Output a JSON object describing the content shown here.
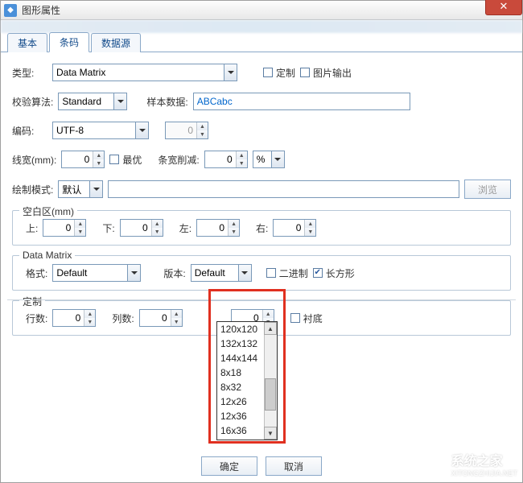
{
  "window": {
    "title": "图形属性"
  },
  "tabs": [
    "基本",
    "条码",
    "数据源"
  ],
  "activeTab": 1,
  "typeRow": {
    "label": "类型:",
    "value": "Data Matrix",
    "custom": "定制",
    "imgout": "图片输出"
  },
  "checkRow": {
    "label": "校验算法:",
    "value": "Standard",
    "sampleLabel": "样本数据:",
    "sampleValue": "ABCabc"
  },
  "encodeRow": {
    "label": "编码:",
    "value": "UTF-8",
    "spin": "0"
  },
  "widthRow": {
    "label": "线宽(mm):",
    "spin": "0",
    "optimal": "最优",
    "reduceLabel": "条宽削减:",
    "reduce": "0",
    "unit": "%"
  },
  "drawRow": {
    "label": "绘制模式:",
    "value": "默认",
    "browse": "浏览"
  },
  "blank": {
    "legend": "空白区(mm)",
    "up": "上:",
    "down": "下:",
    "left": "左:",
    "right": "右:",
    "v": "0"
  },
  "dm": {
    "legend": "Data Matrix",
    "formatLabel": "格式:",
    "format": "Default",
    "versionLabel": "版本:",
    "version": "Default",
    "binary": "二进制",
    "rect": "长方形",
    "rectChecked": true
  },
  "versionOptions": [
    "120x120",
    "132x132",
    "144x144",
    "8x18",
    "8x32",
    "12x26",
    "12x36",
    "16x36"
  ],
  "custom": {
    "legend": "定制",
    "rowsLabel": "行数:",
    "colsLabel": "列数:",
    "v": "0",
    "pad": "衬底"
  },
  "buttons": {
    "ok": "确定",
    "cancel": "取消"
  },
  "watermark": {
    "main": "系统之家",
    "sub": "XITONGZHIJIA.NET"
  }
}
